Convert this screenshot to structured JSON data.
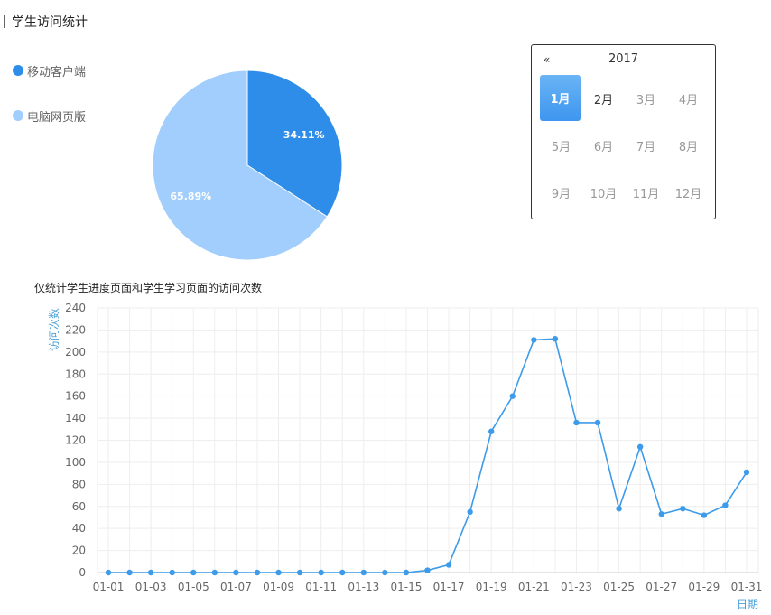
{
  "header": {
    "title": "学生访问统计"
  },
  "pie": {
    "legend": [
      {
        "label": "移动客户端",
        "color": "#2e8de8"
      },
      {
        "label": "电脑网页版",
        "color": "#a1cefc"
      }
    ]
  },
  "calendar": {
    "prev_label": "«",
    "year": "2017",
    "months": [
      "1月",
      "2月",
      "3月",
      "4月",
      "5月",
      "6月",
      "7月",
      "8月",
      "9月",
      "10月",
      "11月",
      "12月"
    ],
    "selected": "1月",
    "enabled": [
      "1月",
      "2月"
    ]
  },
  "line": {
    "subtitle": "仅统计学生进度页面和学生学习页面的访问次数"
  },
  "chart_data": [
    {
      "type": "pie",
      "categories": [
        "移动客户端",
        "电脑网页版"
      ],
      "values": [
        34.11,
        65.89
      ],
      "labels": [
        "34.11%",
        "65.89%"
      ],
      "colors": [
        "#2e8de8",
        "#a1cefc"
      ],
      "legend_position": "left"
    },
    {
      "type": "line",
      "xlabel": "日期",
      "ylabel": "访问次数",
      "ylim": [
        0,
        240
      ],
      "yticks": [
        0,
        20,
        40,
        60,
        80,
        100,
        120,
        140,
        160,
        180,
        200,
        220,
        240
      ],
      "xticks": [
        "01-01",
        "01-03",
        "01-05",
        "01-07",
        "01-09",
        "01-11",
        "01-13",
        "01-15",
        "01-17",
        "01-19",
        "01-21",
        "01-23",
        "01-25",
        "01-27",
        "01-29",
        "01-31"
      ],
      "categories": [
        "01-01",
        "01-02",
        "01-03",
        "01-04",
        "01-05",
        "01-06",
        "01-07",
        "01-08",
        "01-09",
        "01-10",
        "01-11",
        "01-12",
        "01-13",
        "01-14",
        "01-15",
        "01-16",
        "01-17",
        "01-18",
        "01-19",
        "01-20",
        "01-21",
        "01-22",
        "01-23",
        "01-24",
        "01-25",
        "01-26",
        "01-27",
        "01-28",
        "01-29",
        "01-30",
        "01-31"
      ],
      "values": [
        0,
        0,
        0,
        0,
        0,
        0,
        0,
        0,
        0,
        0,
        0,
        0,
        0,
        0,
        0,
        2,
        7,
        55,
        128,
        160,
        211,
        212,
        136,
        136,
        58,
        114,
        53,
        58,
        52,
        61,
        91
      ],
      "color": "#3d9be9",
      "grid": true
    }
  ]
}
